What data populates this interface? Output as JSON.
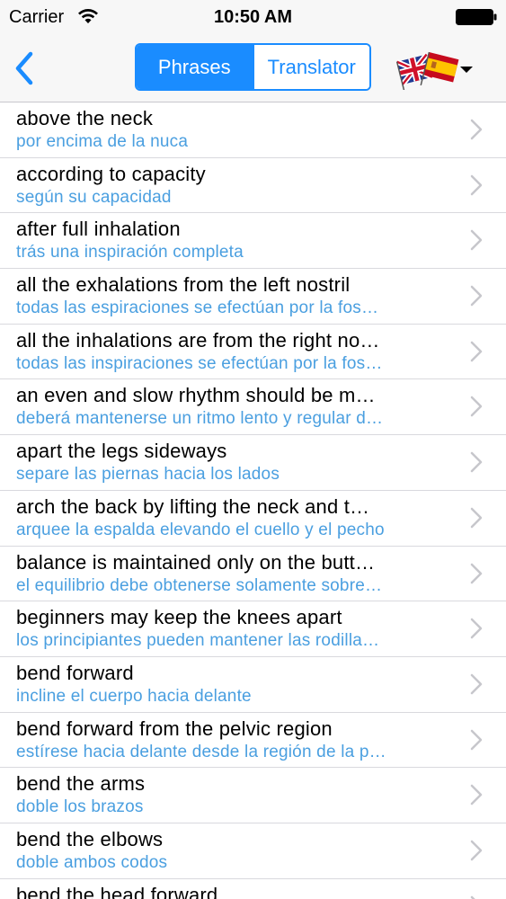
{
  "status_bar": {
    "carrier": "Carrier",
    "time": "10:50 AM"
  },
  "nav": {
    "segments": [
      "Phrases",
      "Translator"
    ],
    "active_segment": "Phrases",
    "accent_color": "#1a8cff",
    "language_icon": "uk-spain-flags-icon"
  },
  "phrases": [
    {
      "en": "above the neck",
      "es": "por encima de la nuca"
    },
    {
      "en": "according to capacity",
      "es": "según su capacidad"
    },
    {
      "en": "after full inhalation",
      "es": "trás una inspiración completa"
    },
    {
      "en": "all the exhalations from the left nostril",
      "es": "todas las espiraciones se efectúan por la fos…"
    },
    {
      "en": "all the inhalations are from the right no…",
      "es": "todas las inspiraciones se efectúan por la fos…"
    },
    {
      "en": "an even and slow rhythm should be m…",
      "es": "deberá mantenerse un ritmo lento y regular d…"
    },
    {
      "en": "apart the legs sideways",
      "es": "separe las piernas hacia los lados"
    },
    {
      "en": "arch the back by lifting the neck and t…",
      "es": "arquee la espalda elevando el cuello y el pecho"
    },
    {
      "en": "balance is maintained only on the butt…",
      "es": "el equilibrio debe obtenerse solamente sobre…"
    },
    {
      "en": "beginners may keep the knees apart",
      "es": "los principiantes pueden mantener las rodilla…"
    },
    {
      "en": "bend forward",
      "es": "incline el cuerpo hacia delante"
    },
    {
      "en": "bend forward from the pelvic region",
      "es": "estírese hacia delante desde la región de la p…"
    },
    {
      "en": "bend the arms",
      "es": "doble los brazos"
    },
    {
      "en": "bend the elbows",
      "es": "doble ambos codos"
    },
    {
      "en": "bend the head forward",
      "es": ""
    }
  ]
}
